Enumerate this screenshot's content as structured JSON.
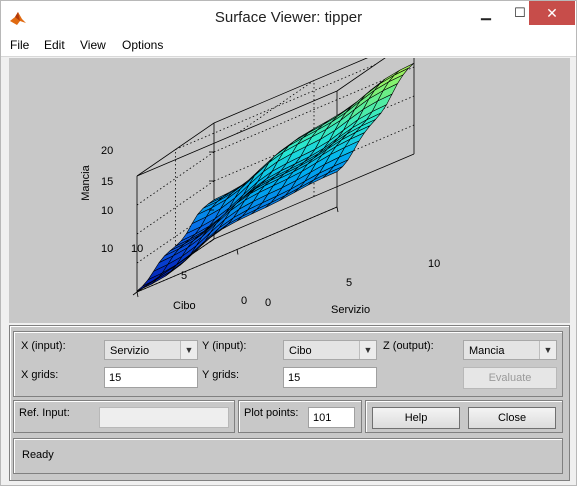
{
  "window": {
    "title": "Surface Viewer: tipper"
  },
  "menu": [
    "File",
    "Edit",
    "View",
    "Options"
  ],
  "plot": {
    "z_label": "Mancia",
    "y_label": "Cibo",
    "x_label": "Servizio",
    "z_ticks": [
      "10",
      "15",
      "20",
      "10"
    ],
    "y_ticks": [
      "0",
      "5",
      "10"
    ],
    "x_ticks": [
      "0",
      "5",
      "10"
    ]
  },
  "controls": {
    "x_input_label": "X (input):",
    "x_input_value": "Servizio",
    "y_input_label": "Y (input):",
    "y_input_value": "Cibo",
    "z_output_label": "Z (output):",
    "z_output_value": "Mancia",
    "x_grids_label": "X grids:",
    "x_grids_value": "15",
    "y_grids_label": "Y grids:",
    "y_grids_value": "15",
    "evaluate_label": "Evaluate",
    "ref_input_label": "Ref. Input:",
    "ref_input_value": "",
    "plot_points_label": "Plot points:",
    "plot_points_value": "101",
    "help_label": "Help",
    "close_label": "Close"
  },
  "status": {
    "text": "Ready"
  }
}
